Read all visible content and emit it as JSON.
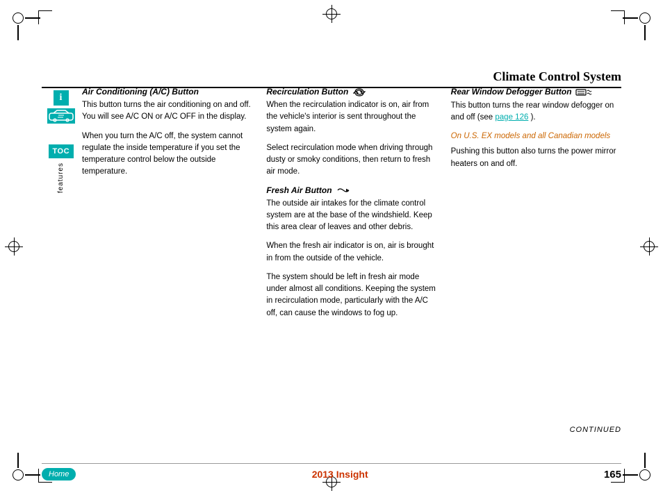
{
  "page": {
    "title": "Climate Control System",
    "footer_title": "2013 Insight",
    "page_number": "165",
    "continued": "CONTINUED",
    "home_label": "Home"
  },
  "sidebar": {
    "toc_label": "TOC",
    "features_label": "Features"
  },
  "columns": {
    "col1": {
      "section_title": "Air Conditioning (A/C) Button",
      "para1": "This button turns the air conditioning on and off. You will see A/C ON or A/C OFF in the display.",
      "para2": "When you turn the A/C off, the system cannot regulate the inside temperature if you set the temperature control below the outside temperature."
    },
    "col2": {
      "section1_title": "Recirculation Button",
      "section1_para1": "When the recirculation indicator is on, air from the vehicle's interior is sent throughout the system again.",
      "section1_para2": "Select recirculation mode when driving through dusty or smoky conditions, then return to fresh air mode.",
      "section2_title": "Fresh Air Button",
      "section2_para1": "The outside air intakes for the climate control system are at the base of the windshield. Keep this area clear of leaves and other debris.",
      "section2_para2": "When the fresh air indicator is on, air is brought in from the outside of the vehicle.",
      "section2_para3": "The system should be left in fresh air mode under almost all conditions. Keeping the system in recirculation mode, particularly with the A/C off, can cause the windows to fog up."
    },
    "col3": {
      "section_title": "Rear Window Defogger Button",
      "para1": "This button turns the rear window defogger on and off (see",
      "page_link": "page 126",
      "para1_end": ").",
      "orange_label": "On U.S. EX models and all Canadian models",
      "para2": "Pushing this button also turns the power mirror heaters on and off."
    }
  }
}
